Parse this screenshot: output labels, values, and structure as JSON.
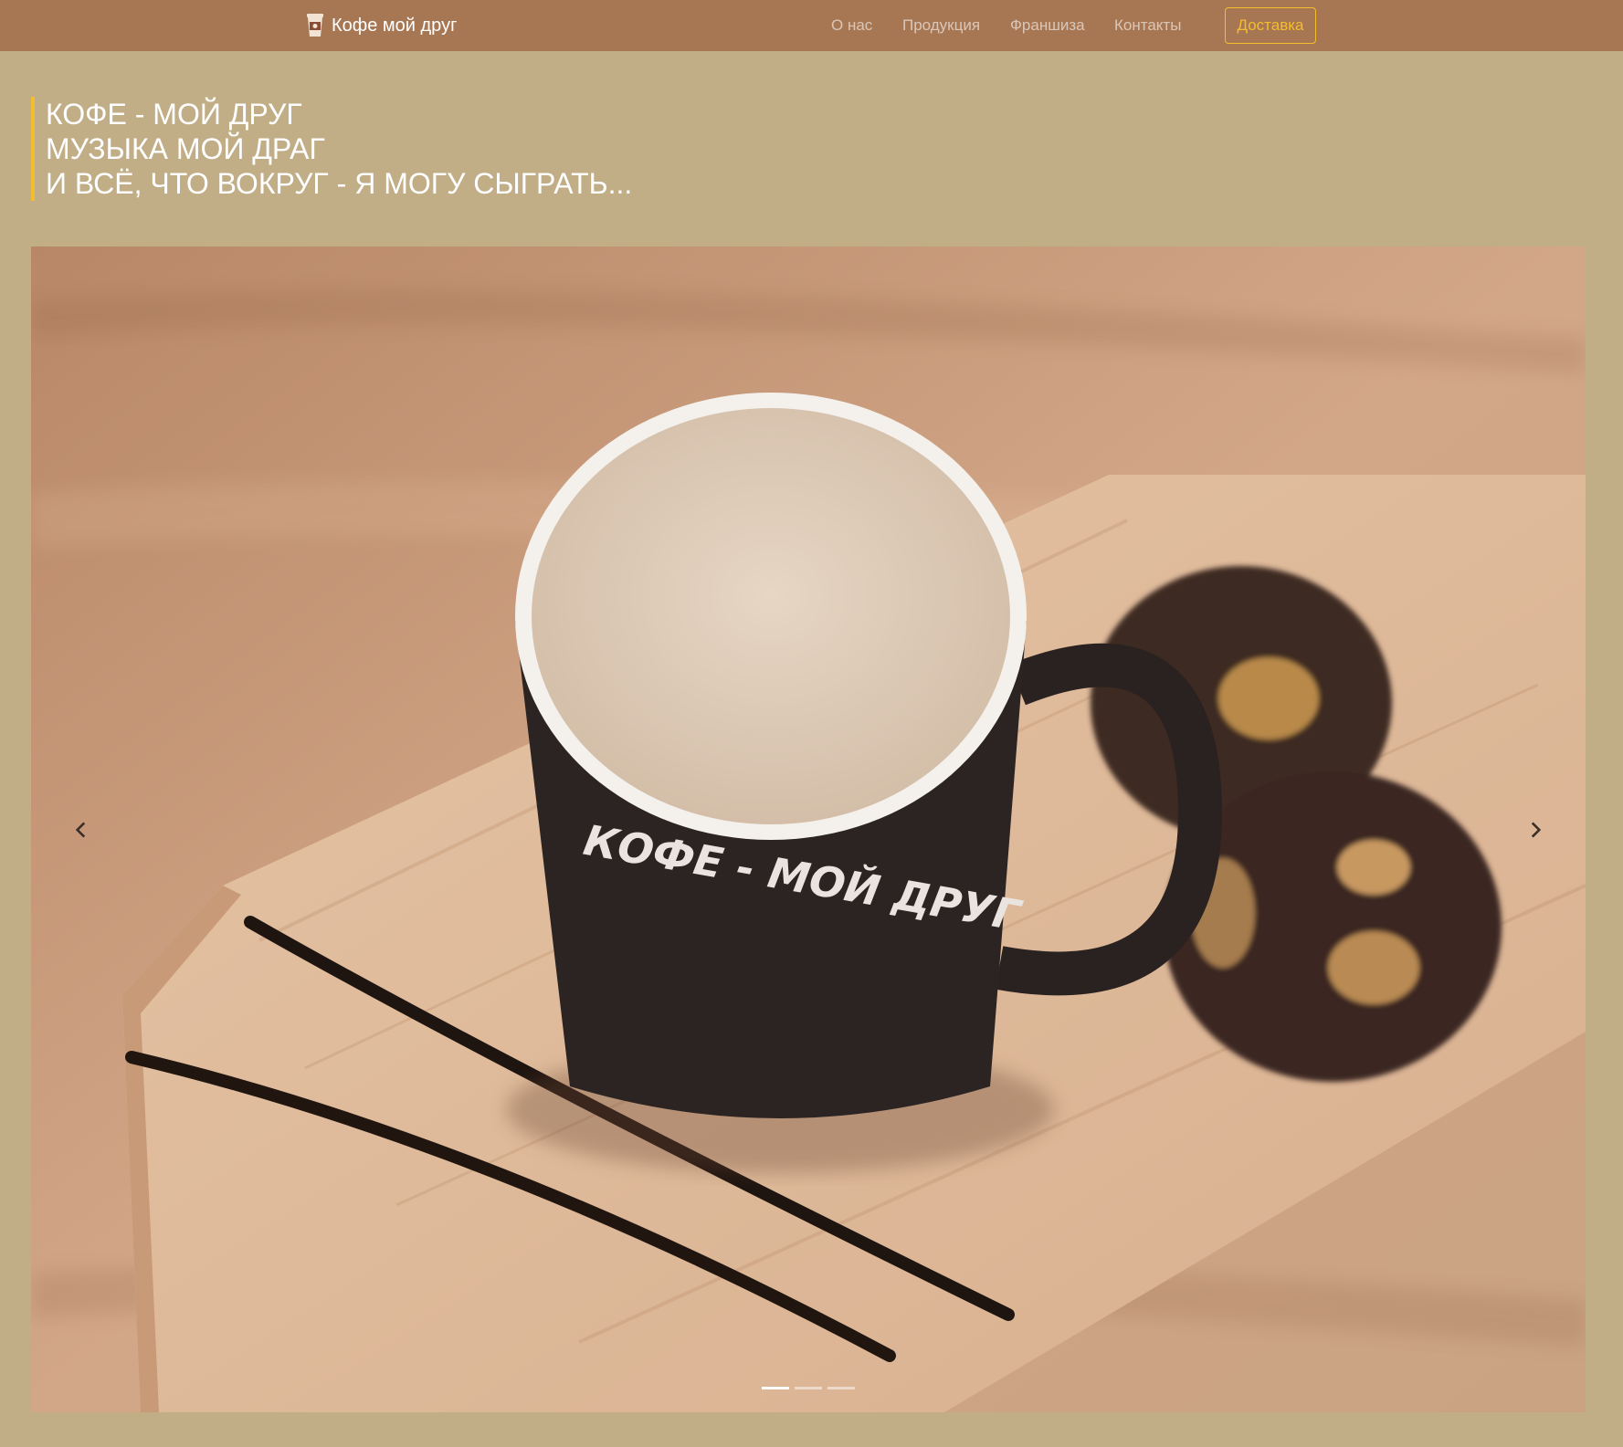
{
  "brand": {
    "name": "Кофе мой друг",
    "icon": "coffee-cup-icon"
  },
  "nav": {
    "items": [
      {
        "label": "О нас"
      },
      {
        "label": "Продукция"
      },
      {
        "label": "Франшиза"
      },
      {
        "label": "Контакты"
      }
    ],
    "delivery_label": "Доставка"
  },
  "hero": {
    "lines": [
      "КОФЕ - МОЙ ДРУГ",
      "МУЗЫКА МОЙ ДРАГ",
      "И ВСЁ, ЧТО ВОКРУГ - Я МОГУ СЫГРАТЬ..."
    ]
  },
  "carousel": {
    "image_icon": "coffee-mug-photo",
    "mug_lettering": "КОФЕ - МОЙ ДРУГ",
    "prev_icon": "chevron-left-icon",
    "next_icon": "chevron-right-icon",
    "slide_count": 3,
    "active_slide": 1
  },
  "colors": {
    "page_bg": "#c1ad86",
    "navbar_bg": "#a77754",
    "accent": "#f3bd2d",
    "text_light": "#ffffff"
  }
}
